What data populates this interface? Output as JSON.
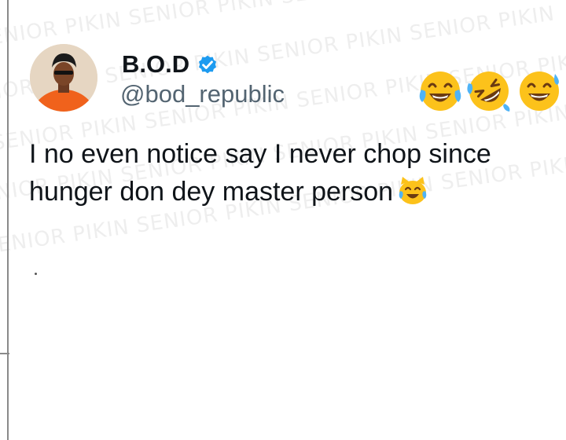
{
  "tweet": {
    "display_name": "B.O.D",
    "handle": "@bod_republic",
    "verified": true,
    "verified_color": "#1d9bf0",
    "text_lines": [
      "I no even notice say I never chop since",
      "hunger don dey master person"
    ],
    "header_emojis": [
      "tears-of-joy-emoji",
      "rolling-on-floor-laughing-emoji",
      "grinning-sweat-emoji"
    ],
    "inline_emoji": "cat-tears-of-joy-emoji"
  },
  "watermark": {
    "text": "SENIOR PIKIN SENIOR PIKIN SENIOR PIKIN SENIOR PIKIN"
  }
}
